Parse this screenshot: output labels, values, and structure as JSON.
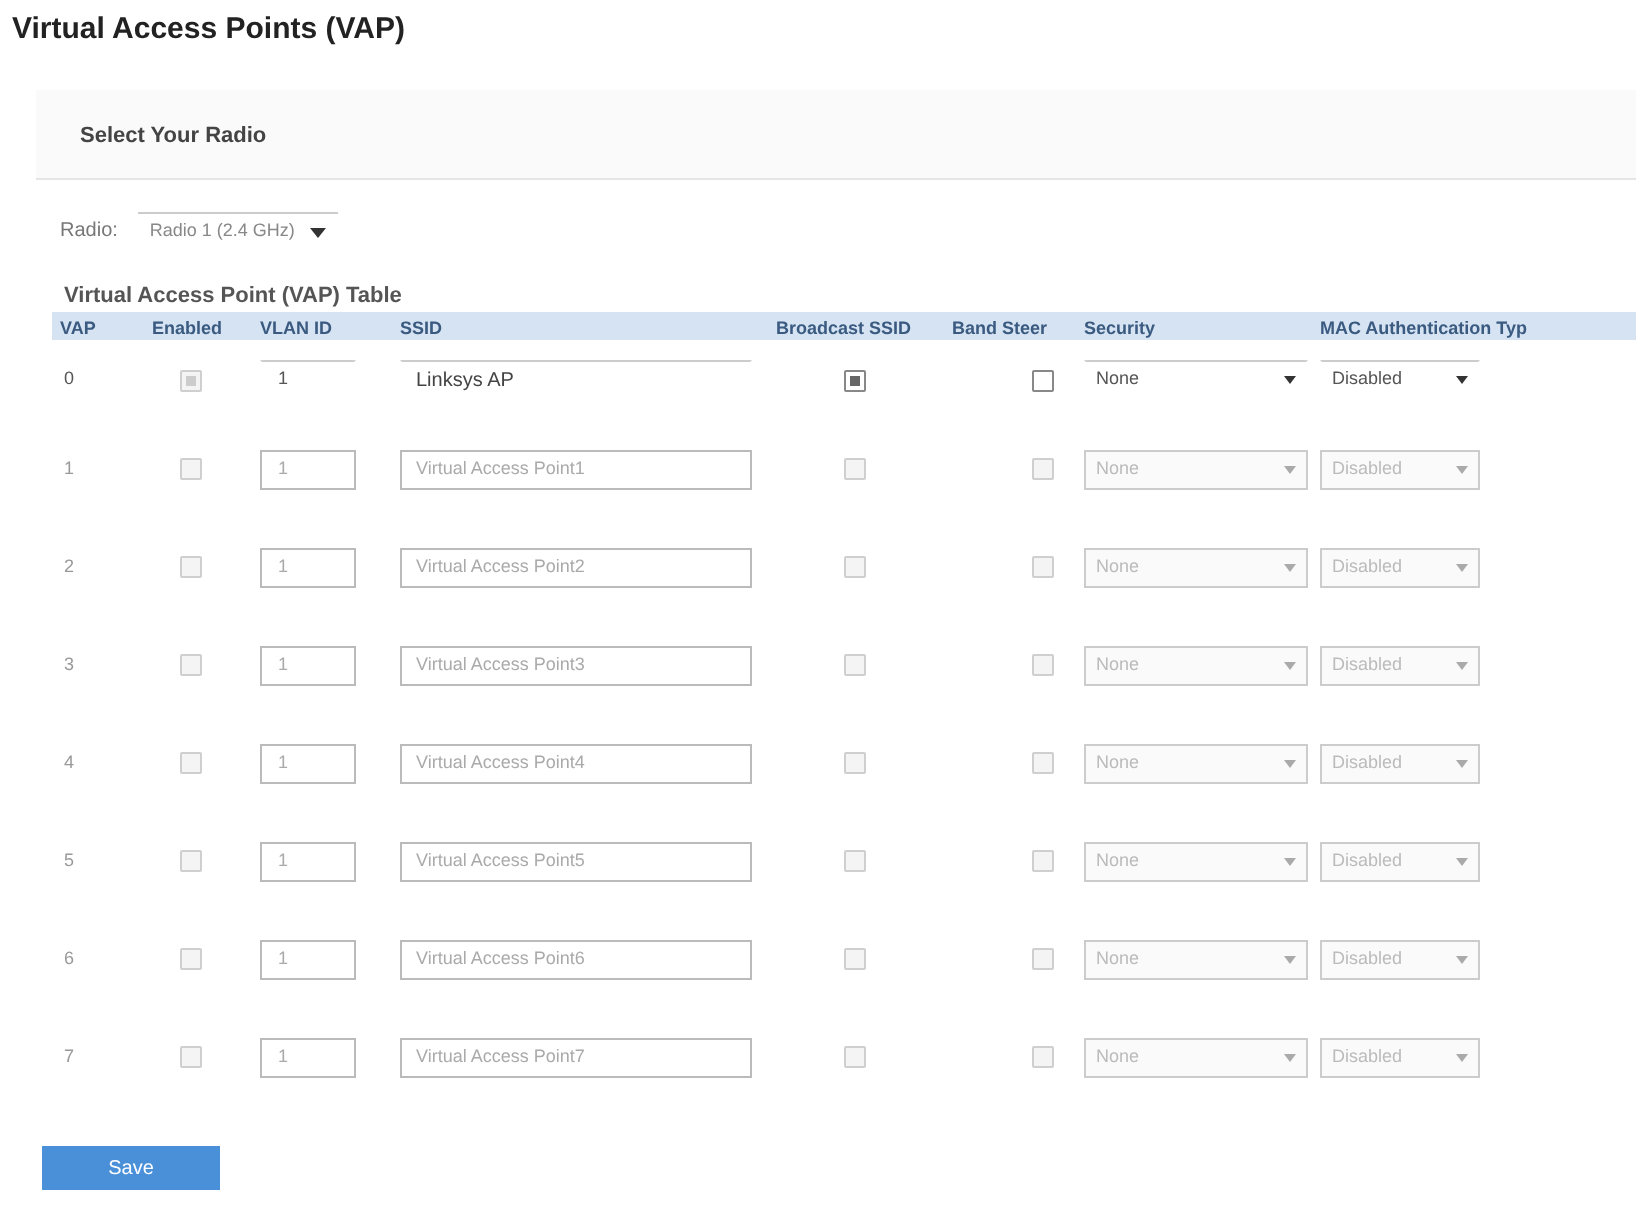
{
  "title": "Virtual Access Points (VAP)",
  "radio_section": {
    "heading": "Select Your Radio",
    "label": "Radio:",
    "value": "Radio 1 (2.4 GHz)"
  },
  "table": {
    "title": "Virtual Access Point (VAP) Table",
    "columns": [
      "VAP",
      "Enabled",
      "VLAN ID",
      "SSID",
      "Broadcast SSID",
      "Band Steer",
      "Security",
      "MAC Authentication Typ"
    ],
    "rows": [
      {
        "vap": "0",
        "disabled": false,
        "enabled": true,
        "vlan_id": "1",
        "ssid": "Linksys AP",
        "broadcast_ssid": true,
        "band_steer": false,
        "security": "None",
        "mac_auth": "Disabled"
      },
      {
        "vap": "1",
        "disabled": true,
        "enabled": false,
        "vlan_id": "1",
        "ssid": "Virtual Access Point1",
        "broadcast_ssid": false,
        "band_steer": false,
        "security": "None",
        "mac_auth": "Disabled"
      },
      {
        "vap": "2",
        "disabled": true,
        "enabled": false,
        "vlan_id": "1",
        "ssid": "Virtual Access Point2",
        "broadcast_ssid": false,
        "band_steer": false,
        "security": "None",
        "mac_auth": "Disabled"
      },
      {
        "vap": "3",
        "disabled": true,
        "enabled": false,
        "vlan_id": "1",
        "ssid": "Virtual Access Point3",
        "broadcast_ssid": false,
        "band_steer": false,
        "security": "None",
        "mac_auth": "Disabled"
      },
      {
        "vap": "4",
        "disabled": true,
        "enabled": false,
        "vlan_id": "1",
        "ssid": "Virtual Access Point4",
        "broadcast_ssid": false,
        "band_steer": false,
        "security": "None",
        "mac_auth": "Disabled"
      },
      {
        "vap": "5",
        "disabled": true,
        "enabled": false,
        "vlan_id": "1",
        "ssid": "Virtual Access Point5",
        "broadcast_ssid": false,
        "band_steer": false,
        "security": "None",
        "mac_auth": "Disabled"
      },
      {
        "vap": "6",
        "disabled": true,
        "enabled": false,
        "vlan_id": "1",
        "ssid": "Virtual Access Point6",
        "broadcast_ssid": false,
        "band_steer": false,
        "security": "None",
        "mac_auth": "Disabled"
      },
      {
        "vap": "7",
        "disabled": true,
        "enabled": false,
        "vlan_id": "1",
        "ssid": "Virtual Access Point7",
        "broadcast_ssid": false,
        "band_steer": false,
        "security": "None",
        "mac_auth": "Disabled"
      }
    ]
  },
  "save_button": "Save"
}
